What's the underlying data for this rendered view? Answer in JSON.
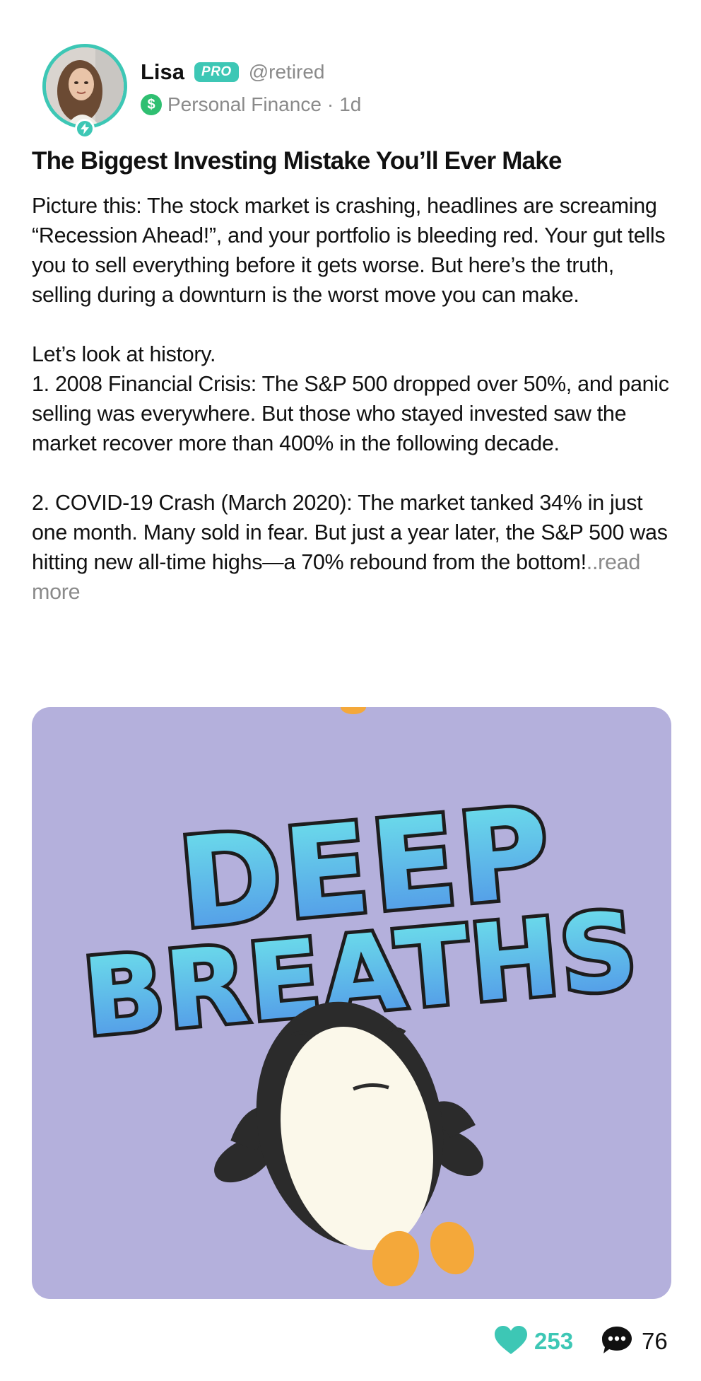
{
  "post": {
    "author": {
      "name": "Lisa",
      "badge": "PRO",
      "handle": "@retired",
      "category": "Personal Finance",
      "time": "1d"
    },
    "title": "The Biggest Investing Mistake You’ll Ever Make",
    "paragraphs": [
      "Picture this: The stock market is crashing, headlines are screaming “Recession Ahead!”, and your portfolio is bleeding red. Your gut tells you to sell everything before it gets worse. But here’s the truth, selling during a downturn is the worst move you can make.",
      "Let’s look at history.",
      "1. 2008 Financial Crisis: The S&P 500 dropped over 50%, and panic selling was everywhere. But those who stayed invested saw the market recover more than 400% in the following decade.",
      "2. COVID-19 Crash (March 2020): The market tanked 34% in just one month. Many sold in fear. But just a year later, the S&P 500 was hitting new all-time highs—a 70% rebound from the bottom!"
    ],
    "read_more": "..read more",
    "media": {
      "line1": "DEEP",
      "line2": "BREATHS"
    },
    "likes": "253",
    "comments": "76"
  },
  "colors": {
    "accent": "#3dc7b5",
    "category_icon": "#2fbf71",
    "muted_text": "#8a8a8a",
    "media_background": "#b4b0dc"
  },
  "icons": [
    "lightning-icon",
    "dollar-icon",
    "heart-icon",
    "comment-bubble-icon"
  ]
}
